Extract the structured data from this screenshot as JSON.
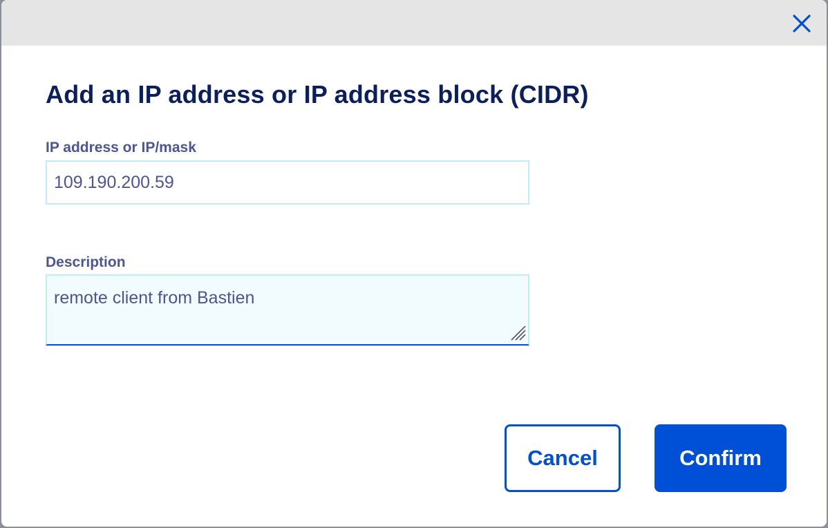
{
  "dialog": {
    "title": "Add an IP address or IP address block (CIDR)",
    "close_icon": "close-icon"
  },
  "form": {
    "ip_label": "IP address or IP/mask",
    "ip_value": "109.190.200.59",
    "description_label": "Description",
    "description_value": "remote client from Bastien"
  },
  "actions": {
    "cancel_label": "Cancel",
    "confirm_label": "Confirm"
  },
  "colors": {
    "primary": "#0050d7",
    "title": "#0b1f5c",
    "label": "#4d5693",
    "input_border": "#bfeef5",
    "header_bg": "#e5e5e5"
  }
}
